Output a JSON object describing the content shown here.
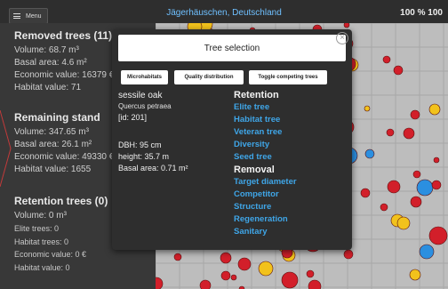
{
  "topbar": {
    "menu_label": "Menu",
    "location": "Jägerhäuschen, Deutschland",
    "zoom": "100 % 100"
  },
  "removed": {
    "title": "Removed trees (11)",
    "volume": "Volume: 68.7 m³",
    "basal_area": "Basal area: 4.6 m²",
    "economic": "Economic value: 16379 €",
    "habitat": "Habitat value: 71"
  },
  "remaining": {
    "title": "Remaining stand",
    "volume": "Volume: 347.65 m³",
    "basal_area": "Basal area: 26.1 m²",
    "economic": "Economic value: 49330 €",
    "habitat": "Habitat value: 1655"
  },
  "retention": {
    "title": "Retention trees (0)",
    "volume": "Volume: 0 m³",
    "elite": "Elite trees: 0",
    "habitat_trees": "Habitat trees: 0",
    "economic": "Economic value: 0 €",
    "habitat": "Habitat value: 0"
  },
  "dialog": {
    "title": "Tree selection",
    "close_icon": "close-icon",
    "tabs": [
      "Microhabitats",
      "Quality distribution",
      "Toggle competing trees"
    ],
    "tree": {
      "common_name": "sessile oak",
      "latin_name": "Quercus petraea",
      "id": "[id: 201]",
      "dbh": "DBH: 95 cm",
      "height": "height: 35.7 m",
      "basal_area": "Basal area: 0.71 m²"
    },
    "retention_heading": "Retention",
    "retention_options": [
      "Elite tree",
      "Habitat tree",
      "Veteran tree",
      "Diversity",
      "Seed tree"
    ],
    "removal_heading": "Removal",
    "removal_options": [
      "Target diameter",
      "Competitor",
      "Structure",
      "Regeneration",
      "Sanitary"
    ]
  },
  "colors": {
    "link": "#3fa6e8",
    "location": "#6fc0ff",
    "tree_red": "#d21f2a",
    "tree_yellow": "#f2c21c",
    "tree_blue": "#2b8fe0"
  }
}
